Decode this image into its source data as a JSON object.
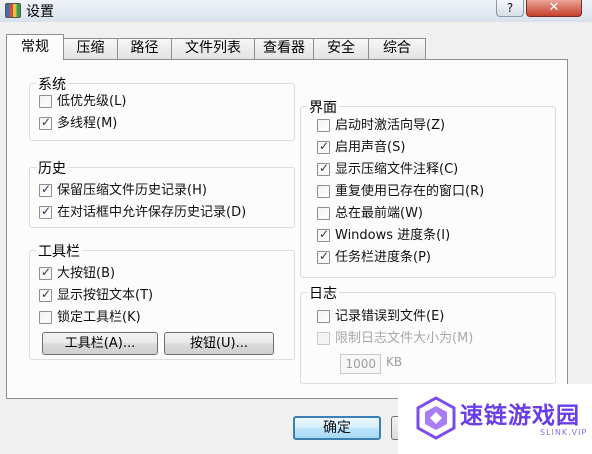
{
  "window": {
    "title": "设置",
    "help_label": "?",
    "close_label": "✕"
  },
  "tabs": [
    {
      "label": "常规",
      "active": true
    },
    {
      "label": "压缩",
      "active": false
    },
    {
      "label": "路径",
      "active": false
    },
    {
      "label": "文件列表",
      "active": false
    },
    {
      "label": "查看器",
      "active": false
    },
    {
      "label": "安全",
      "active": false
    },
    {
      "label": "综合",
      "active": false
    }
  ],
  "groups": {
    "system": {
      "title": "系统",
      "options": [
        {
          "label": "低优先级(L)",
          "checked": false
        },
        {
          "label": "多线程(M)",
          "checked": true
        }
      ]
    },
    "history": {
      "title": "历史",
      "options": [
        {
          "label": "保留压缩文件历史记录(H)",
          "checked": true
        },
        {
          "label": "在对话框中允许保存历史记录(D)",
          "checked": true
        }
      ]
    },
    "toolbar": {
      "title": "工具栏",
      "options": [
        {
          "label": "大按钮(B)",
          "checked": true
        },
        {
          "label": "显示按钮文本(T)",
          "checked": true
        },
        {
          "label": "锁定工具栏(K)",
          "checked": false
        }
      ],
      "buttons": [
        "工具栏(A)...",
        "按钮(U)..."
      ]
    },
    "interface": {
      "title": "界面",
      "options": [
        {
          "label": "启动时激活向导(Z)",
          "checked": false
        },
        {
          "label": "启用声音(S)",
          "checked": true
        },
        {
          "label": "显示压缩文件注释(C)",
          "checked": true
        },
        {
          "label": "重复使用已存在的窗口(R)",
          "checked": false
        },
        {
          "label": "总在最前端(W)",
          "checked": false
        },
        {
          "label": "Windows 进度条(I)",
          "checked": true
        },
        {
          "label": "任务栏进度条(P)",
          "checked": true
        }
      ]
    },
    "log": {
      "title": "日志",
      "options": [
        {
          "label": "记录错误到文件(E)",
          "checked": false,
          "disabled": false
        },
        {
          "label": "限制日志文件大小为(M)",
          "checked": false,
          "disabled": true
        }
      ],
      "size_value": "1000",
      "size_unit": "KB"
    }
  },
  "footer": {
    "ok_label": "确定"
  },
  "watermark": {
    "name": "速链游戏园",
    "url": "SLINK.VIP"
  },
  "colors": {
    "accent_focus": "#3c7fb1",
    "watermark": "#6a3de8"
  }
}
